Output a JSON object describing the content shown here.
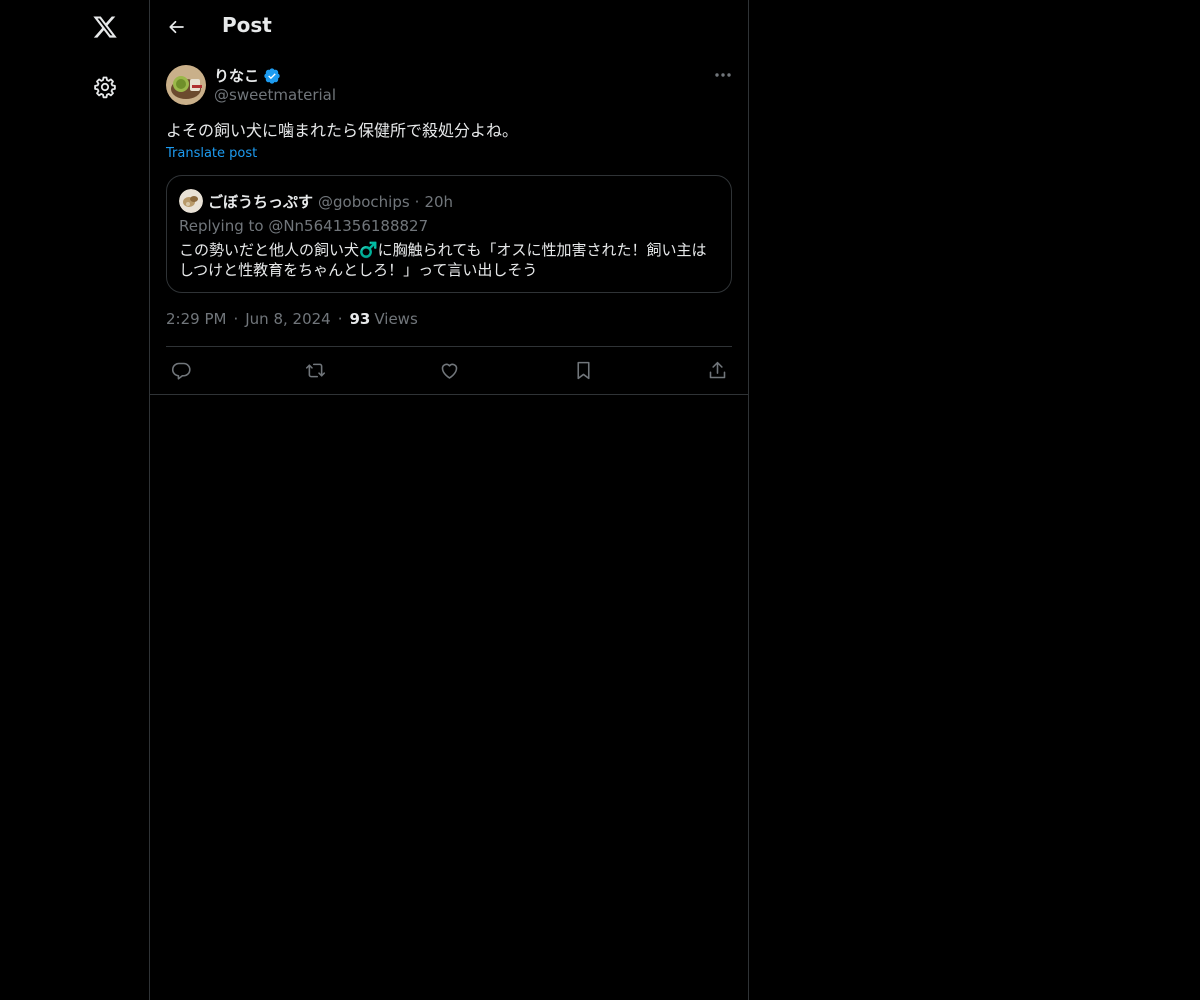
{
  "icons": {
    "logo": "x-logo-icon",
    "settings": "gear-icon",
    "back": "arrow-left-icon",
    "verified": "verified-badge-icon",
    "more": "more-horizontal-icon",
    "reply": "reply-icon",
    "repost": "repost-icon",
    "like": "heart-icon",
    "bookmark": "bookmark-icon",
    "share": "share-icon"
  },
  "colors": {
    "background": "#000000",
    "text": "#e7e9ea",
    "muted": "#71767b",
    "accent": "#1d9bf0",
    "border": "#2f3336"
  },
  "header": {
    "title": "Post"
  },
  "post": {
    "author_name": "りなこ",
    "author_handle": "@sweetmaterial",
    "text": "よその飼い犬に噛まれたら保健所で殺処分よね。",
    "translate_label": "Translate post",
    "time": "2:29 PM",
    "date": "Jun 8, 2024",
    "separator": "·",
    "views_count": "93",
    "views_label": "Views"
  },
  "quote": {
    "author_name": "ごぼうちっぷす",
    "author_handle": "@gobochips",
    "separator": "·",
    "time_ago": "20h",
    "replying_to": "Replying to @Nn5641356188827",
    "text": "この勢いだと他人の飼い犬♂️に胸触られても「オスに性加害された！飼い主はしつけと性教育をちゃんとしろ！」って言い出しそう"
  }
}
